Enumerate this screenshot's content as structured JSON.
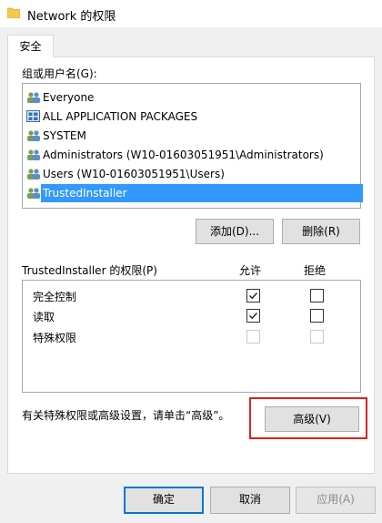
{
  "window": {
    "title": "Network 的权限"
  },
  "tabs": [
    {
      "label": "安全"
    }
  ],
  "group_section": {
    "label": "组或用户名(G):",
    "items": [
      {
        "label": "Everyone",
        "icon": "users-icon"
      },
      {
        "label": "ALL APPLICATION PACKAGES",
        "icon": "app-packages-icon"
      },
      {
        "label": "SYSTEM",
        "icon": "users-icon"
      },
      {
        "label": "Administrators (W10-01603051951\\Administrators)",
        "icon": "users-icon"
      },
      {
        "label": "Users (W10-01603051951\\Users)",
        "icon": "users-icon"
      },
      {
        "label": "TrustedInstaller",
        "icon": "users-icon",
        "selected": true
      }
    ]
  },
  "buttons": {
    "add": "添加(D)...",
    "remove": "删除(R)",
    "advanced": "高级(V)",
    "ok": "确定",
    "cancel": "取消",
    "apply": "应用(A)"
  },
  "permissions": {
    "label": "TrustedInstaller 的权限(P)",
    "allow_header": "允许",
    "deny_header": "拒绝",
    "rows": [
      {
        "name": "完全控制",
        "allow": true,
        "deny": false,
        "enabled": true
      },
      {
        "name": "读取",
        "allow": true,
        "deny": false,
        "enabled": true
      },
      {
        "name": "特殊权限",
        "allow": false,
        "deny": false,
        "enabled": false
      }
    ]
  },
  "advanced_hint": "有关特殊权限或高级设置，请单击“高级”。",
  "colors": {
    "selection": "#3399ff",
    "highlight_box": "#e02020",
    "default_button_border": "#0078d7"
  }
}
